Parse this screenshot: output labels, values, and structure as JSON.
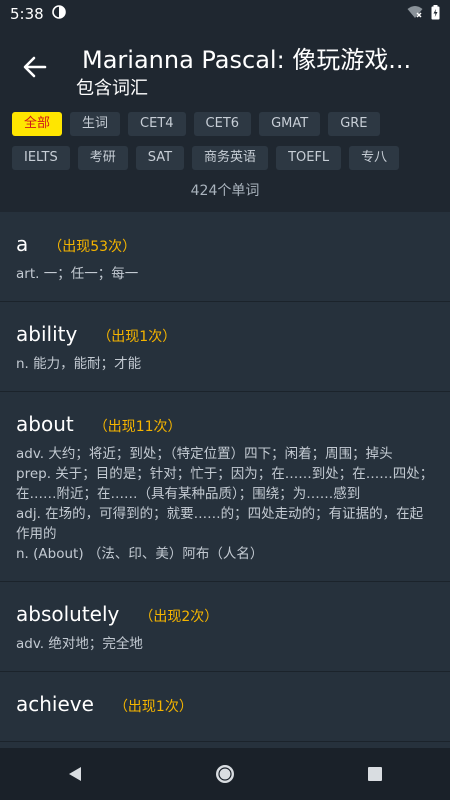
{
  "status": {
    "time": "5:38"
  },
  "header": {
    "title": "Marianna Pascal: 像玩游戏...",
    "subtitle": "包含词汇"
  },
  "tags": {
    "row1": [
      "全部",
      "生词",
      "CET4",
      "CET6",
      "GMAT",
      "GRE"
    ],
    "row2": [
      "IELTS",
      "考研",
      "SAT",
      "商务英语",
      "TOEFL",
      "专八"
    ]
  },
  "count": "424个单词",
  "words": [
    {
      "word": "a",
      "freq": "（出现53次）",
      "defs": [
        "art. 一；任一；每一"
      ]
    },
    {
      "word": "ability",
      "freq": "（出现1次）",
      "defs": [
        "n. 能力，能耐；才能"
      ]
    },
    {
      "word": "about",
      "freq": "（出现11次）",
      "defs": [
        "adv. 大约；将近；到处；（特定位置）四下；闲着；周围；掉头",
        "prep. 关于；目的是；针对；忙于；因为；在……到处；在……四处；在……附近；在……（具有某种品质）；围绕；为……感到",
        "adj. 在场的，可得到的；就要……的；四处走动的；有证据的，在起作用的",
        "n. (About) （法、印、美）阿布（人名）"
      ]
    },
    {
      "word": "absolutely",
      "freq": "（出现2次）",
      "defs": [
        "adv. 绝对地；完全地"
      ]
    },
    {
      "word": "achieve",
      "freq": "（出现1次）",
      "defs": [
        ""
      ]
    }
  ],
  "colors": {
    "accent": "#ffe600",
    "freq": "#f4b400",
    "background": "#1f2730"
  }
}
